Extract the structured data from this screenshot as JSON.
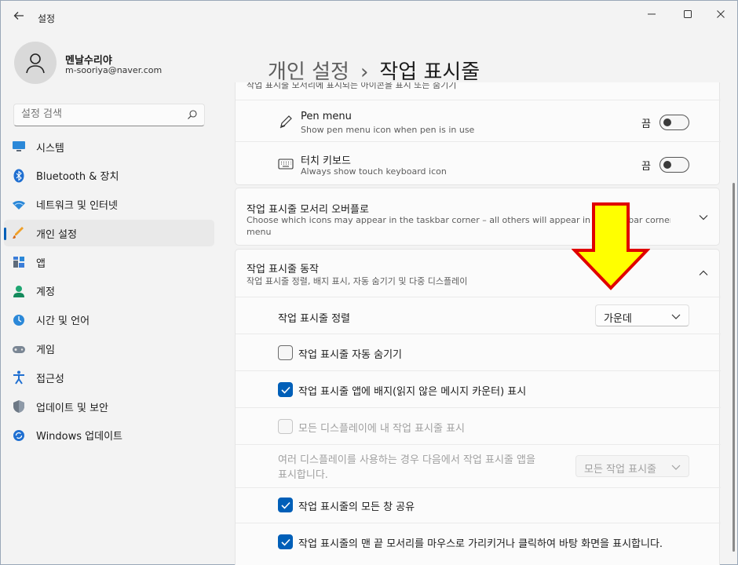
{
  "window": {
    "title": "설정",
    "back_icon": "back-arrow-icon",
    "minimize_icon": "minimize-icon",
    "maximize_icon": "maximize-icon",
    "close_icon": "close-icon"
  },
  "account": {
    "name": "멘날수리야",
    "email": "m-sooriya@naver.com"
  },
  "search": {
    "placeholder": "설정 검색"
  },
  "nav": {
    "items": [
      {
        "label": "시스템",
        "icon": "system-icon"
      },
      {
        "label": "Bluetooth & 장치",
        "icon": "bluetooth-icon"
      },
      {
        "label": "네트워크 및 인터넷",
        "icon": "network-icon"
      },
      {
        "label": "개인 설정",
        "icon": "personalization-icon",
        "active": true
      },
      {
        "label": "앱",
        "icon": "apps-icon"
      },
      {
        "label": "계정",
        "icon": "accounts-icon"
      },
      {
        "label": "시간 및 언어",
        "icon": "time-language-icon"
      },
      {
        "label": "게임",
        "icon": "gaming-icon"
      },
      {
        "label": "접근성",
        "icon": "accessibility-icon"
      },
      {
        "label": "업데이트 및 보안",
        "icon": "security-icon"
      },
      {
        "label": "Windows 업데이트",
        "icon": "windows-update-icon"
      }
    ]
  },
  "header": {
    "parent": "개인 설정",
    "separator": "›",
    "current": "작업 표시줄"
  },
  "taskbar_icons": {
    "truncated_text": "작업 표시줄 모서리에 표시되는 아이콘을 표시 또는 숨기기",
    "pen_menu": {
      "title": "Pen menu",
      "desc": "Show pen menu icon when pen is in use",
      "state": "끔"
    },
    "touch_keyboard": {
      "title": "터치 키보드",
      "desc": "Always show touch keyboard icon",
      "state": "끔"
    }
  },
  "corner_overflow": {
    "title": "작업 표시줄 모서리 오버플로",
    "desc_line1": "Choose which icons may appear in the taskbar corner – all others will appear in the taskbar corner overflow",
    "desc_line2": "menu"
  },
  "behaviors": {
    "title": "작업 표시줄 동작",
    "desc": "작업 표시줄 정렬, 배지 표시, 자동 숨기기 및 다중 디스플레이",
    "alignment_label": "작업 표시줄 정렬",
    "alignment_value": "가운데",
    "auto_hide": {
      "label": "작업 표시줄 자동 숨기기",
      "checked": false
    },
    "badges": {
      "label": "작업 표시줄 앱에 배지(읽지 않은 메시지 카운터) 표시",
      "checked": true
    },
    "all_displays": {
      "label": "모든 디스플레이에 내 작업 표시줄 표시",
      "checked": false,
      "disabled": true
    },
    "multi_display_line1": "여러 디스플레이를 사용하는 경우 다음에서 작업 표시줄 앱을",
    "multi_display_line2": "표시합니다.",
    "multi_display_value": "모든 작업 표시줄",
    "share_window": {
      "label": "작업 표시줄의 모든 창 공유",
      "checked": true
    },
    "far_corner": {
      "label": "작업 표시줄의 맨 끝 모서리를 마우스로 가리키거나 클릭하여 바탕 화면을 표시합니다.",
      "checked": true
    }
  },
  "annotation": {
    "arrow_color": "#ffff00",
    "arrow_border": "#e00000"
  },
  "colors": {
    "accent": "#005fb8"
  }
}
